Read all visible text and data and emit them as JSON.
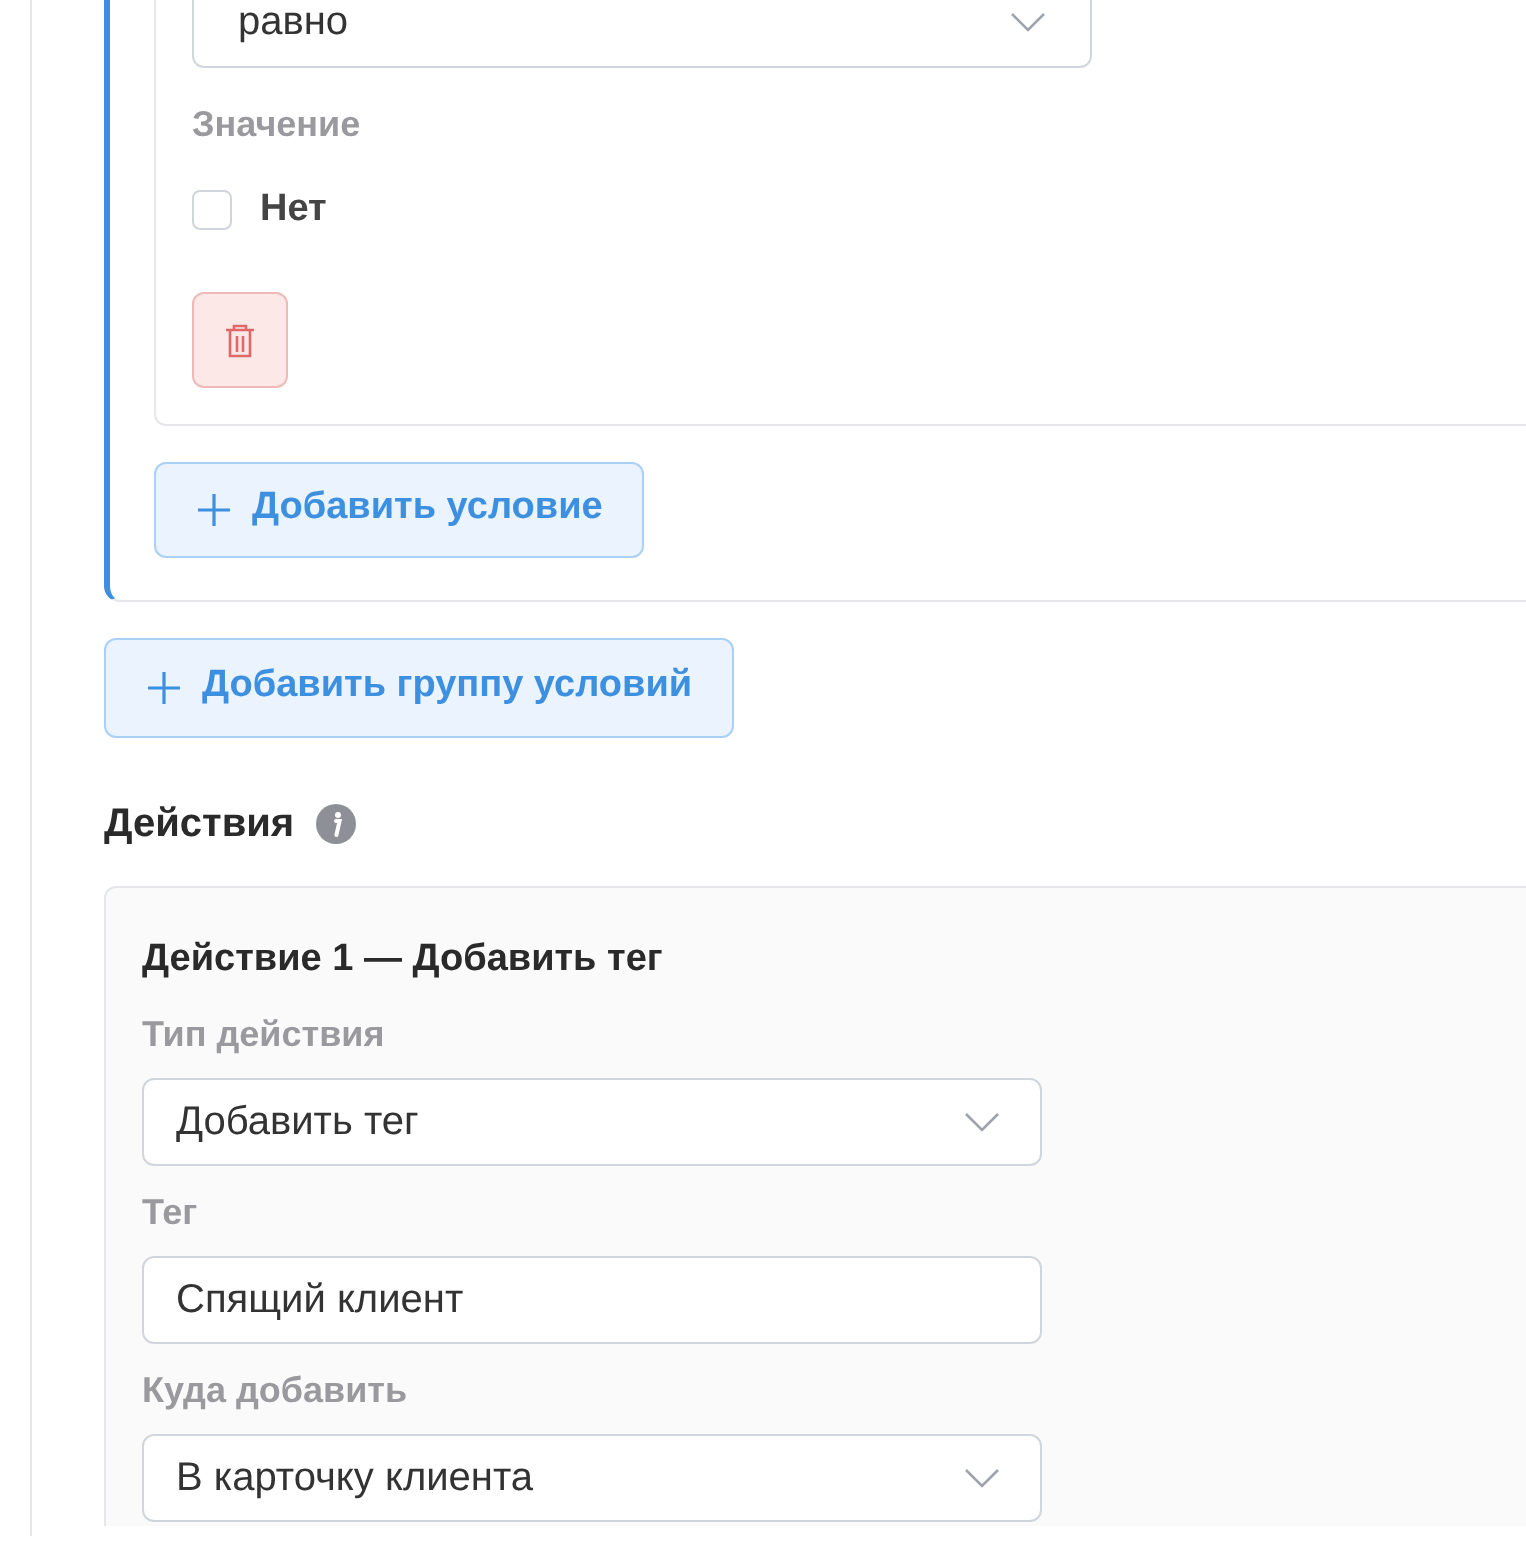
{
  "condition": {
    "operator_select": {
      "value": "равно"
    },
    "value_label": "Значение",
    "checkbox": {
      "label": "Нет",
      "checked": false
    }
  },
  "add_condition_button": "Добавить условие",
  "add_group_button": "Добавить группу условий",
  "actions": {
    "heading": "Действия",
    "items": [
      {
        "title": "Действие 1 — Добавить тег",
        "fields": [
          {
            "kind": "select",
            "label": "Тип действия",
            "value": "Добавить тег"
          },
          {
            "kind": "input",
            "label": "Тег",
            "value": "Спящий клиент"
          },
          {
            "kind": "select",
            "label": "Куда добавить",
            "value": "В карточку клиента"
          }
        ]
      }
    ]
  }
}
